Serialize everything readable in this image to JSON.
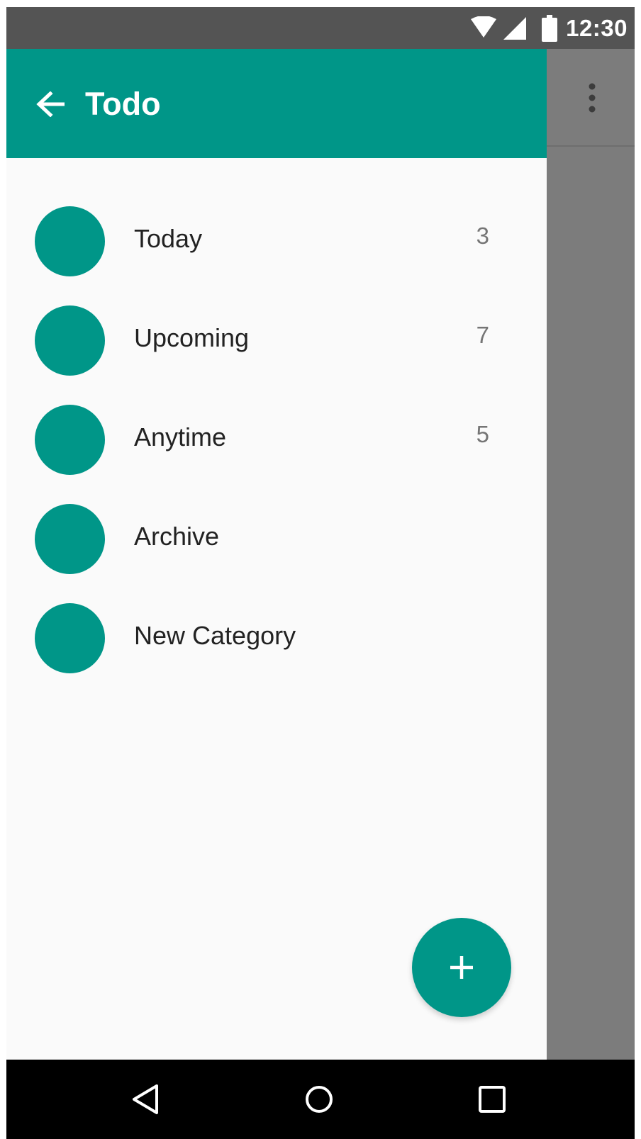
{
  "status_bar": {
    "time": "12:30",
    "icons": [
      "wifi-icon",
      "cellular-signal-icon",
      "battery-icon"
    ]
  },
  "drawer": {
    "title": "Todo",
    "back_icon": "arrow-back-icon",
    "categories": [
      {
        "label": "Today",
        "count": "3"
      },
      {
        "label": "Upcoming",
        "count": "7"
      },
      {
        "label": "Anytime",
        "count": "5"
      },
      {
        "label": "Archive",
        "count": ""
      },
      {
        "label": "New Category",
        "count": ""
      }
    ],
    "fab_icon": "add-icon"
  },
  "toolbar": {
    "overflow_icon": "more-vert-icon"
  },
  "nav_bar": {
    "icons": [
      "back-triangle-icon",
      "home-circle-icon",
      "recents-square-icon"
    ]
  },
  "colors": {
    "primary": "#009688",
    "status_bar": "#545454",
    "drawer_background": "#fafafa",
    "scrim": "#7c7c7c",
    "nav_bar": "#000000"
  }
}
